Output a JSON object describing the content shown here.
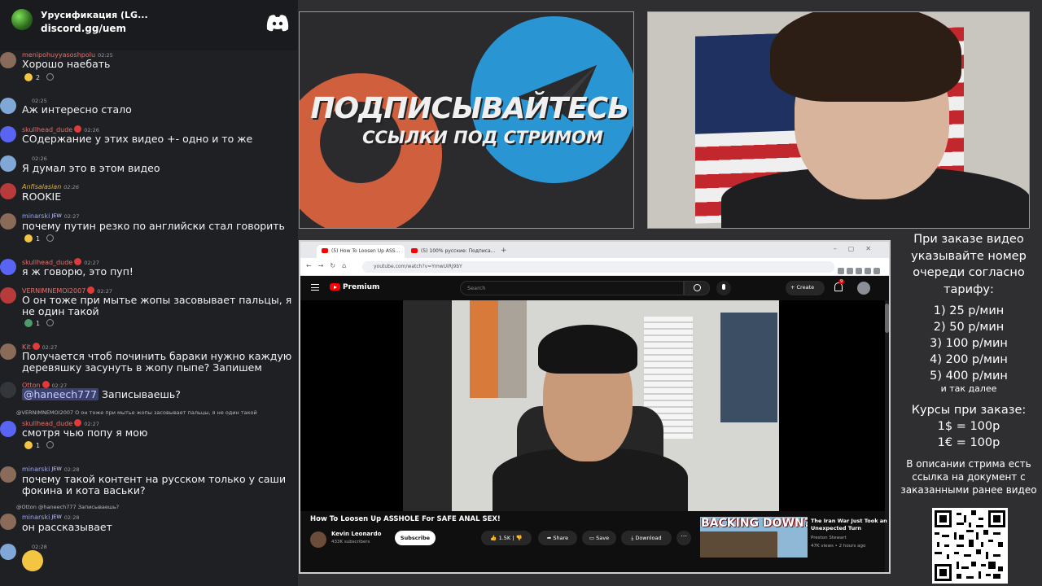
{
  "discord": {
    "server_name": "Урусификация (LG...",
    "invite": "discord.gg/uem"
  },
  "messages": [
    {
      "user": "menipohuyyasoshpolu",
      "time": "02:25",
      "text": "Хорошо наебать",
      "reaction": "2"
    },
    {
      "user": "",
      "time": "02:25",
      "text": "Аж интересно стало"
    },
    {
      "user": "skullhead_dude",
      "time": "02:26",
      "text": "СОдержание у этих видео +- одно и то же"
    },
    {
      "user": "",
      "time": "02:26",
      "text": "Я думал это в этом видео"
    },
    {
      "user": "Anfisalasian",
      "time": "02:26",
      "text": "ROOKIE"
    },
    {
      "user": "minarski",
      "tag": "JEW",
      "time": "02:27",
      "text": "почему путин резко по английски стал говорить",
      "reaction": "1"
    },
    {
      "user": "skullhead_dude",
      "time": "02:27",
      "text": "я ж говорю, это пуп!"
    },
    {
      "user": "VERNIMNEMOI2007",
      "time": "02:27",
      "text": "О он тоже при мытье жопы засовывает пальцы, я не один такой",
      "reaction": "1"
    },
    {
      "user": "Kit",
      "time": "02:27",
      "text": "Получается чтоб починить бараки нужно каждую деревяшку засунуть в жопу пыпе? Запишем"
    },
    {
      "user": "Otton",
      "time": "02:27",
      "mention": "@haneech777",
      "text": "Записываешь?"
    },
    {
      "reply": "@VERNIMNEMOI2007  О он тоже при мытье жопы засовывает пальцы, я не один такой",
      "user": "skullhead_dude",
      "time": "02:27",
      "text": "смотря чью попу я мою",
      "reaction": "1"
    },
    {
      "user": "minarski",
      "tag": "JEW",
      "time": "02:28",
      "text": "почему такой контент на русском только у саши фокина и кота васьки?"
    },
    {
      "reply": "@Otton  @haneech777  Записываешь?",
      "user": "minarski",
      "tag": "JEW",
      "time": "02:28",
      "text": "он рассказывает"
    },
    {
      "user": "",
      "time": "02:28",
      "text": ""
    }
  ],
  "promo": {
    "title": "ПОДПИСЫВАЙТЕСЬ",
    "subtitle": "ССЫЛКИ ПОД СТРИМОМ"
  },
  "browser": {
    "tab1": "(5) How To Loosen Up ASS...",
    "tab2": "(5) 100% русские: Подписа...",
    "url": "youtube.com/watch?v=YmwUiRj9bY"
  },
  "youtube": {
    "brand": "Premium",
    "search_placeholder": "Search",
    "create_label": "+ Create",
    "bell_count": "9",
    "video_title": "How To Loosen Up ASSHOLE For SAFE ANAL SEX!",
    "channel": "Kevin Leonardo",
    "subscribers": "433K subscribers",
    "subscribe_label": "Subscribe",
    "likes": "1.5K",
    "share_label": "Share",
    "save_label": "Save",
    "download_label": "Download",
    "suggestion": {
      "thumb_text": "BACKING DOWN?",
      "title": "The Iran War Just Took an Unexpected Turn",
      "channel": "Preston Stewart",
      "meta": "47K views • 2 hours ago"
    }
  },
  "info_panel": {
    "title": "При заказе видео указывайте номер очереди согласно тарифу:",
    "rates": [
      "1) 25 р/мин",
      "2) 50 р/мин",
      "3) 100 р/мин",
      "4) 200 р/мин",
      "5) 400 р/мин"
    ],
    "more": "и так далее",
    "currency_title": "Курсы при заказе:",
    "currencies": [
      "1$ = 100р",
      "1€ = 100р"
    ],
    "description": "В описании стрима есть ссылка на документ с заказанными ранее видео"
  },
  "colors": {
    "discord_bg": "#1f2023",
    "username_red": "#e8706b",
    "username_blue": "#9aa6ff",
    "telegram_blue": "#2a95d3",
    "youtube_red": "#ff0000"
  }
}
